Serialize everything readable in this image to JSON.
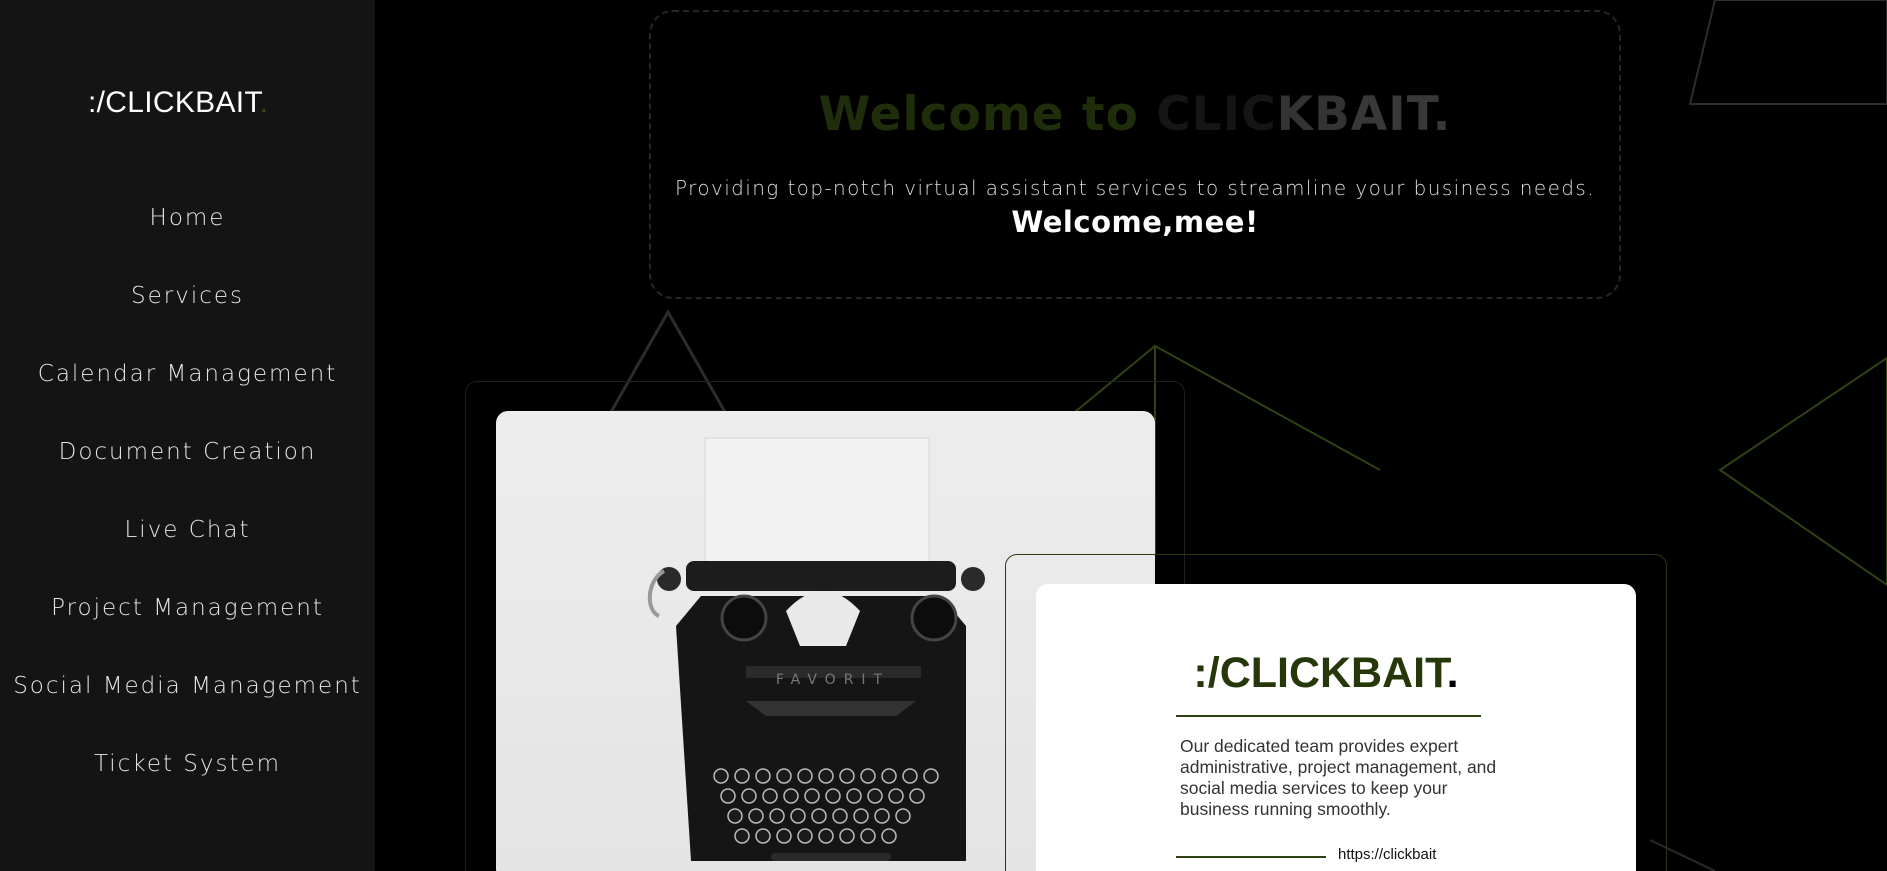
{
  "sidebar": {
    "logo": ":/CLICKBAIT",
    "logo_dot": ".",
    "items": [
      {
        "label": "Home"
      },
      {
        "label": "Services"
      },
      {
        "label": "Calendar Management"
      },
      {
        "label": "Document Creation"
      },
      {
        "label": "Live Chat"
      },
      {
        "label": "Project Management"
      },
      {
        "label": "Social Media Management"
      },
      {
        "label": "Ticket System"
      }
    ]
  },
  "hero": {
    "title_part1": "Welcome to ",
    "title_part2": "CLIC",
    "title_part3": "KB",
    "title_part4": "AIT.",
    "subtitle": "Providing top-notch virtual assistant services to streamline your business needs.",
    "welcome": "Welcome,mee!"
  },
  "info_card": {
    "logo": ":/CLICKBAIT",
    "logo_dot": ".",
    "description": "Our dedicated team provides expert administrative, project management, and social media services to keep your business running smoothly.",
    "link": "https://clickbait"
  },
  "colors": {
    "accent_green": "#2f4212",
    "sidebar_bg": "#141414",
    "page_bg": "#000000"
  }
}
